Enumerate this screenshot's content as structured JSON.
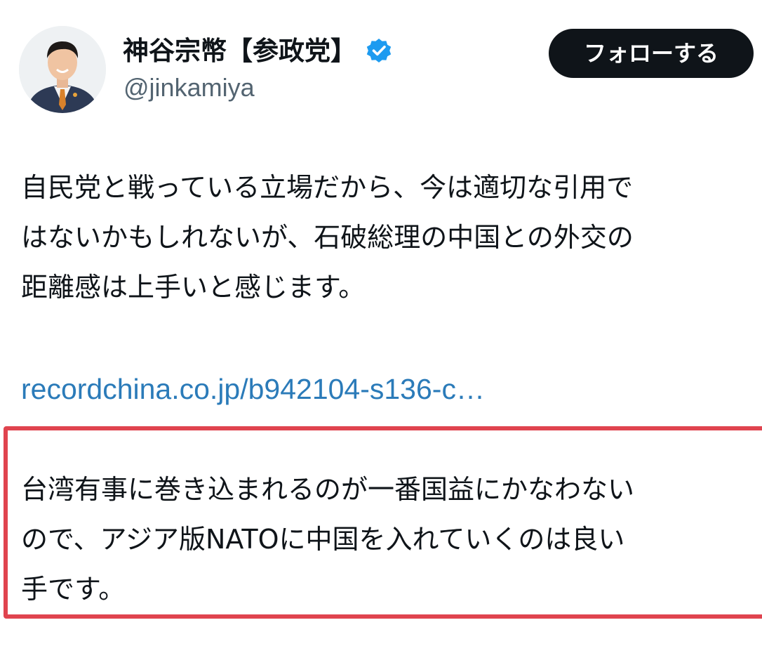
{
  "author": {
    "display_name": "神谷宗幣【参政党】",
    "handle": "@jinkamiya",
    "verified_icon": "verified-badge-icon",
    "avatar_icon": "profile-photo"
  },
  "follow_button": {
    "label": "フォローする"
  },
  "tweet": {
    "text_lines": [
      "自民党と戦っている立場だから、今は適切な引用で",
      "はないかもしれないが、石破総理の中国との外交の",
      "距離感は上手いと感じます。"
    ],
    "link_text": "recordchina.co.jp/b942104-s136-c…",
    "highlighted_lines": [
      "台湾有事に巻き込まれるのが一番国益にかなわない",
      "ので、アジア版NATOに中国を入れていくのは良い",
      "手です。"
    ]
  },
  "colors": {
    "text": "#0f1419",
    "secondary_text": "#536471",
    "link": "#2b7bb9",
    "verified": "#1d9bf0",
    "follow_button_bg": "#0f1419",
    "highlight_border": "#e0444f"
  }
}
